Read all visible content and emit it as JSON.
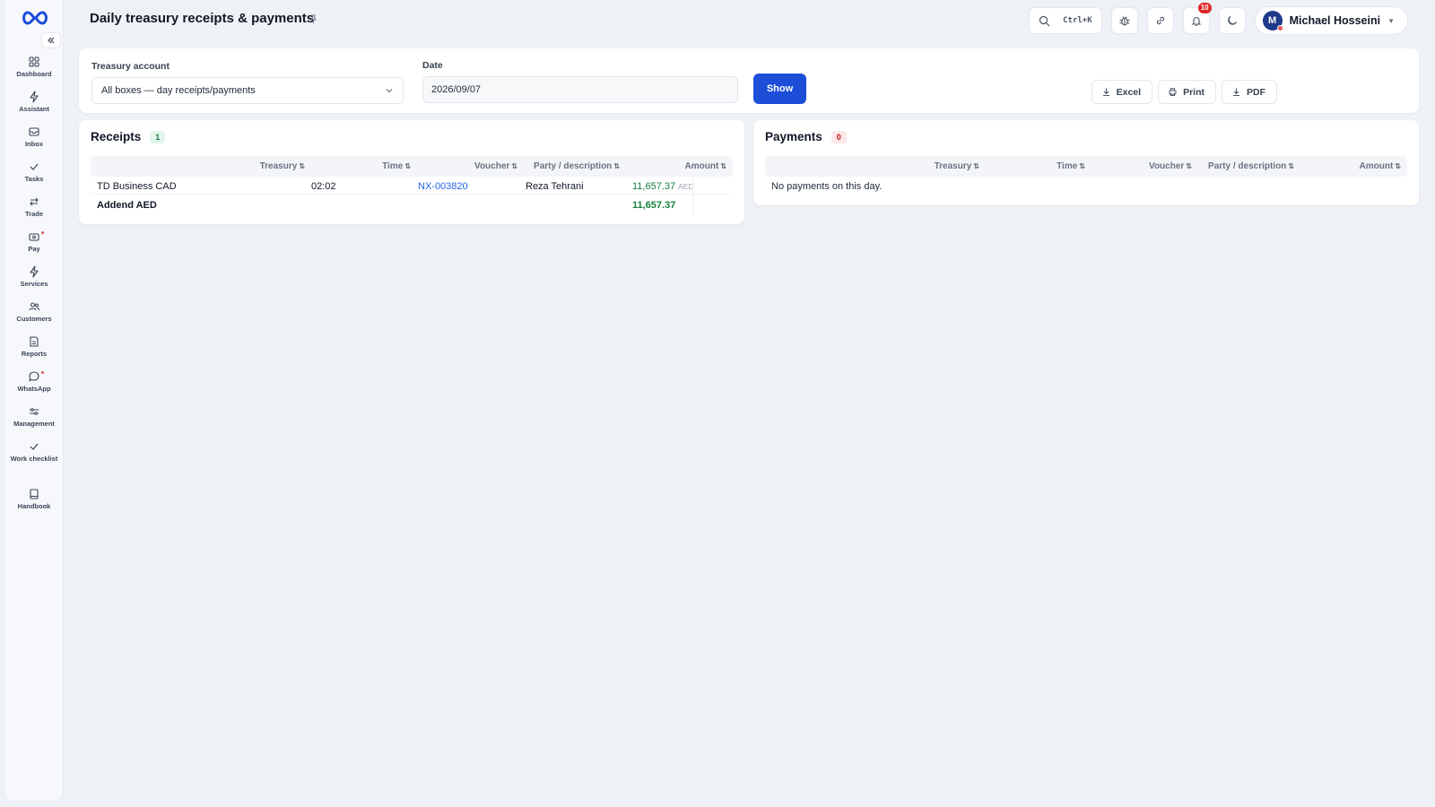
{
  "header": {
    "title": "Daily treasury receipts & payments",
    "search_shortcut": "Ctrl+K",
    "notification_count": "10",
    "user_initial": "M",
    "user_name": "Michael Hosseini"
  },
  "sidebar": {
    "items": [
      {
        "label": "Dashboard",
        "icon": "dashboard-icon"
      },
      {
        "label": "Assistant",
        "icon": "bolt-icon"
      },
      {
        "label": "Inbox",
        "icon": "inbox-icon"
      },
      {
        "label": "Tasks",
        "icon": "check-icon"
      },
      {
        "label": "Trade",
        "icon": "swap-icon"
      },
      {
        "label": "Pay",
        "icon": "wallet-icon"
      },
      {
        "label": "Services",
        "icon": "bolt-icon"
      },
      {
        "label": "Customers",
        "icon": "users-icon"
      },
      {
        "label": "Reports",
        "icon": "report-icon"
      },
      {
        "label": "WhatsApp",
        "icon": "chat-icon"
      },
      {
        "label": "Management",
        "icon": "sliders-icon"
      },
      {
        "label": "Work checklist",
        "icon": "check-icon"
      },
      {
        "label": "Handbook",
        "icon": "book-icon"
      }
    ]
  },
  "filters": {
    "treasury_label": "Treasury account",
    "treasury_value": "All boxes — day receipts/payments",
    "date_label": "Date",
    "date_value": "2026/09/07",
    "show_label": "Show",
    "excel_label": "Excel",
    "print_label": "Print",
    "pdf_label": "PDF"
  },
  "columns": {
    "treasury": "Treasury",
    "time": "Time",
    "voucher": "Voucher",
    "party": "Party / description",
    "amount": "Amount",
    "sort_glyph": "⇅"
  },
  "receipts": {
    "title": "Receipts",
    "count": "1",
    "rows": [
      {
        "treasury": "TD Business CAD",
        "time": "02:02",
        "voucher": "NX-003820",
        "party": "Reza Tehrani",
        "amount": "11,657.37",
        "currency": "AED"
      }
    ],
    "total_label": "Addend AED",
    "total_amount": "11,657.37"
  },
  "payments": {
    "title": "Payments",
    "count": "0",
    "empty_text": "No payments on this day."
  },
  "colors": {
    "primary": "#1d4ed8",
    "positive": "#15803d",
    "badge_red": "#dc2626"
  }
}
